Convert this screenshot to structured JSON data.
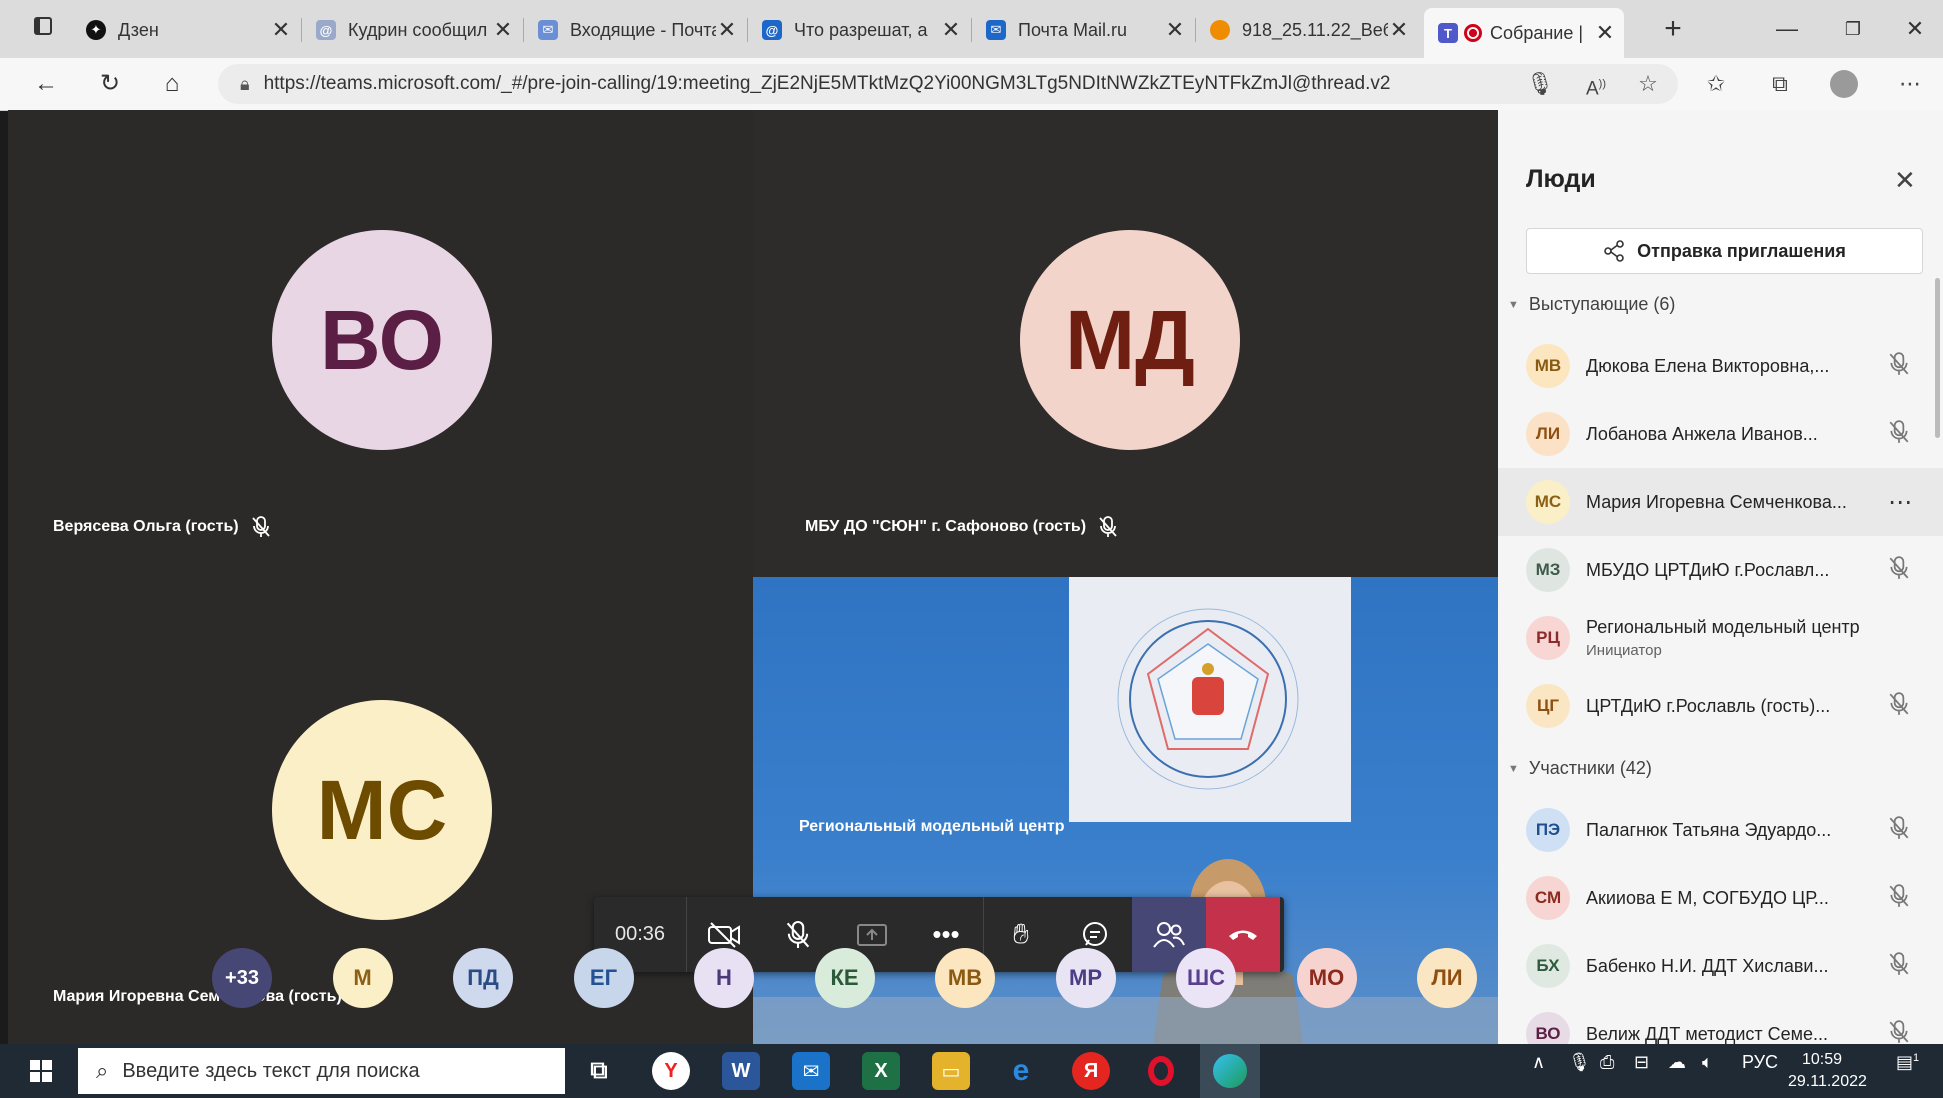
{
  "browser": {
    "tabs": [
      {
        "title": "Дзен",
        "favicon": "dzen-icon",
        "color": "#111111"
      },
      {
        "title": "Кудрин сообщил",
        "favicon": "mailru-icon",
        "color": "#9aa9c9"
      },
      {
        "title": "Входящие - Почта",
        "favicon": "mail-icon",
        "color": "#6a8fd6"
      },
      {
        "title": "Что разрешат, а",
        "favicon": "mailru-icon",
        "color": "#1d67c9"
      },
      {
        "title": "Почта Mail.ru",
        "favicon": "mail-icon",
        "color": "#1d67c9"
      },
      {
        "title": "918_25.11.22_Веб",
        "favicon": "doc-icon",
        "color": "#f08c00"
      },
      {
        "title": "Собрание |",
        "favicon": "teams-icon",
        "color": "#5059c9"
      }
    ],
    "url": "https://teams.microsoft.com/_#/pre-join-calling/19:meeting_ZjE2NjE5MTktMzQ2Yi00NGM3LTg5NDItNWZkZTEyNTFkZmJl@thread.v2",
    "new_tab_symbol": "+"
  },
  "stage": {
    "tiles": [
      {
        "initials": "ВО",
        "name": "Верясева Ольга (гость)",
        "bg": "#e9d6e4",
        "fg": "#5b1e45"
      },
      {
        "initials": "МД",
        "name": "МБУ ДО \"СЮН\" г. Сафоново (гость)",
        "bg": "#f3d4cb",
        "fg": "#6f1f12"
      },
      {
        "initials": "МС",
        "name": "Мария Игоревна Семченкова (гость)",
        "bg": "#fbefc8",
        "fg": "#6d4c00"
      },
      {
        "name": "Региональный модельный центр"
      }
    ],
    "call": {
      "timer": "00:36"
    },
    "strip": [
      {
        "initials": "+33",
        "bg": "#464775",
        "fg": "#ffffff"
      },
      {
        "initials": "М",
        "bg": "#fbefc8",
        "fg": "#8a6116"
      },
      {
        "initials": "ПД",
        "bg": "#cfd9ee",
        "fg": "#2c4a84"
      },
      {
        "initials": "ЕГ",
        "bg": "#c7d6ea",
        "fg": "#245094"
      },
      {
        "initials": "Н",
        "bg": "#e7e1f3",
        "fg": "#4b3a7a"
      },
      {
        "initials": "КЕ",
        "bg": "#d9ecdc",
        "fg": "#2a5a37"
      },
      {
        "initials": "МВ",
        "bg": "#fbe6c0",
        "fg": "#8a5a12"
      },
      {
        "initials": "МР",
        "bg": "#e8e4f3",
        "fg": "#4d3d84"
      },
      {
        "initials": "ШС",
        "bg": "#eae4f6",
        "fg": "#5a3f8f"
      },
      {
        "initials": "МО",
        "bg": "#f6d3cf",
        "fg": "#8c2a1e"
      },
      {
        "initials": "ЛИ",
        "bg": "#fbe6c4",
        "fg": "#8e4f10"
      }
    ]
  },
  "people": {
    "title": "Люди",
    "invite_label": "Отправка приглашения",
    "presenters_label": "Выступающие (6)",
    "presenters": [
      {
        "initials": "МВ",
        "name": "Дюкова Елена Викторовна,...",
        "bg": "#fbe6c0",
        "fg": "#8a5a12",
        "icon": "mic-off-icon"
      },
      {
        "initials": "ЛИ",
        "name": "Лобанова Анжела Иванов...",
        "bg": "#fbe1c6",
        "fg": "#8e4f10",
        "icon": "mic-off-icon"
      },
      {
        "initials": "МС",
        "name": "Мария Игоревна Семченкова...",
        "bg": "#fbefc8",
        "fg": "#8a6116",
        "icon": "more-icon"
      },
      {
        "initials": "МЗ",
        "name": "МБУДО ЦРТДиЮ г.Рославл...",
        "bg": "#dfe6e2",
        "fg": "#3d5a4a",
        "icon": "mic-off-icon"
      },
      {
        "initials": "РЦ",
        "name": "Региональный модельный центр",
        "sub": "Инициатор",
        "bg": "#f7d6d4",
        "fg": "#8c2a2a",
        "icon": ""
      },
      {
        "initials": "ЦГ",
        "name": "ЦРТДиЮ г.Рославль (гость)...",
        "bg": "#fbe6c4",
        "fg": "#8e4f10",
        "icon": "mic-off-icon"
      }
    ],
    "participants_label": "Участники (42)",
    "participants": [
      {
        "initials": "ПЭ",
        "name": "Палагнюк Татьяна Эдуардо...",
        "bg": "#cfe0f4",
        "fg": "#1f4f8c",
        "icon": "mic-off-icon"
      },
      {
        "initials": "СМ",
        "name": "Акииова Е М, СОГБУДО ЦР...",
        "bg": "#f6d5d2",
        "fg": "#8c2a1e",
        "icon": "mic-off-icon"
      },
      {
        "initials": "БХ",
        "name": "Бабенко Н.И. ДДТ Хислави...",
        "bg": "#dfe9e1",
        "fg": "#2f5a3c",
        "icon": "mic-off-icon"
      },
      {
        "initials": "ВО",
        "name": "Велиж ДДТ методист Семе...",
        "bg": "#e7dbe5",
        "fg": "#5b1e45",
        "icon": "mic-off-icon"
      }
    ]
  },
  "taskbar": {
    "search_placeholder": "Введите здесь текст для поиска",
    "lang": "РУС",
    "time": "10:59",
    "date": "29.11.2022",
    "notif_count": "1"
  }
}
